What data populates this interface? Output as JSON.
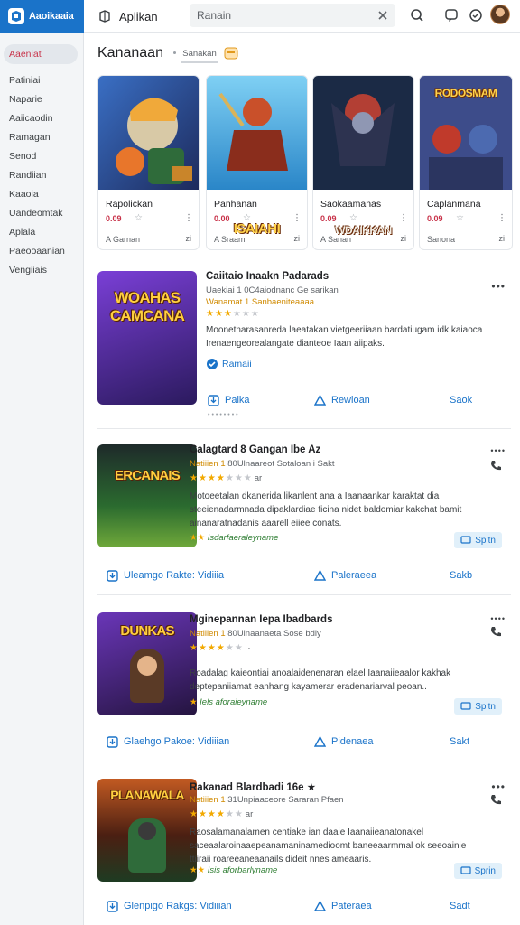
{
  "brand": {
    "name": "Aaoikaaia"
  },
  "header": {
    "app_title": "Aplikan",
    "search_value": "Ranain"
  },
  "sidebar": {
    "items": [
      {
        "label": "Aaeniat",
        "active": true
      },
      {
        "label": "Patiniai"
      },
      {
        "label": "Naparie"
      },
      {
        "label": "Aaiicaodin"
      },
      {
        "label": "Ramagan"
      },
      {
        "label": "Senod"
      },
      {
        "label": "Randiian"
      },
      {
        "label": "Kaaoia"
      },
      {
        "label": "Uandeomtak"
      },
      {
        "label": "Aplala"
      },
      {
        "label": "Paeooaanian"
      },
      {
        "label": "Vengiiais"
      }
    ]
  },
  "main": {
    "title": "Kananaan",
    "sub_tab": "Sanakan"
  },
  "featured": [
    {
      "title": "Rapolickan",
      "price": "0.09",
      "footer": "A Garnan",
      "footer_icon": "zi",
      "art_text": "",
      "colors": [
        "#f0a93a",
        "#3b2a6b"
      ]
    },
    {
      "title": "Panhanan",
      "price": "0.00",
      "footer": "A Sraam",
      "footer_icon": "zi",
      "art_text": "ISAIAHI",
      "colors": [
        "#4fb2e8",
        "#c9502a"
      ]
    },
    {
      "title": "Saokaamanas",
      "price": "0.09",
      "footer": "A Sanan",
      "footer_icon": "zi",
      "art_text": "WDAIKKAN",
      "colors": [
        "#1b2a45",
        "#d9452f"
      ]
    },
    {
      "title": "Caplanmana",
      "price": "0.09",
      "footer": "Sanona",
      "footer_icon": "zi",
      "art_text": "RODOSMAM",
      "colors": [
        "#3d4c8a",
        "#c03a2b"
      ]
    }
  ],
  "list": [
    {
      "title": "Caiitaio Inaakn Padarads",
      "meta_prefix": "Uaekiai 1 ",
      "meta": "0C4aiodnanc Ge sarikan",
      "meta2": "Wanamat 1 Sanbaeniteaaaa",
      "stars_on": 3,
      "stars_off": 3,
      "score": "",
      "desc": "Moonetnarasanreda laeatakan vietgeeriiaan bardatiugam idk kaiaoca Irenaengeorealangate dianteoe Iaan aiipaks.",
      "link": "Ramaii",
      "tag": "",
      "button": "",
      "art_text": "WOAHAS CAMCANA",
      "colors": [
        "#6a3bc4",
        "#f29c2b"
      ],
      "actions": [
        "Paika",
        "Rewloan",
        "Saok"
      ]
    },
    {
      "title": "Calagtard 8 Gangan Ibe Az",
      "meta_prefix": "Natiiien 1 ",
      "meta": "80Ulnaareot Sotaloan i Sakt",
      "meta2": "",
      "stars_on": 4,
      "stars_off": 3,
      "score": "ar",
      "desc": "Motoeetalan dkanerida likanlent ana a Iaanaankar karaktat dia steeienadarmnada dipaklardiae ficina nidet baldomiar kakchat bamit ainanaratnadanis aaarell eiiee conats.",
      "link": "Uleamgo Rakte: Vidiiia",
      "tag": "Isdarfaeraleyname",
      "button": "Spitn",
      "art_text": "ERCANAIS",
      "colors": [
        "#2b6b2f",
        "#b24a1e"
      ],
      "actions": [
        "Uleamgo Rakte: Vidiiia",
        "Paleraeea",
        "Sakb"
      ]
    },
    {
      "title": "Mginepannan Iepa Ibadbards",
      "meta_prefix": "Natiiien 1 ",
      "meta": "80Ulnaanaeta Sose bdiy",
      "meta2": "",
      "stars_on": 4,
      "stars_off": 2,
      "score": "",
      "desc": "Roadalag kaieontiai anoalaidenenaran elael Iaanaiieaalor kakhak deptepaniiamat eanhang kayamerar eradenariarval peoan..",
      "link": "Glaehgo Pakoe: Vidiiian",
      "tag": "Iels aforaieyname",
      "button": "Spitn",
      "art_text": "DUNKAS",
      "colors": [
        "#5a2a8c",
        "#e4a33b"
      ],
      "actions": [
        "Glaehgo Pakoe: Vidiiian",
        "Pidenaea",
        "Sakt"
      ]
    },
    {
      "title": "Rakanad Blardbadi 16e",
      "meta_prefix": "Natiiien 1 ",
      "meta": "31Unpiaaceore Sararan Pfaen",
      "meta2": "",
      "stars_on": 4,
      "stars_off": 2,
      "score": "ar",
      "desc": "Raosalamanalamen centiake ian daaie Iaanaiieanatonakel saceaalaroinaaepeanamaninamedioomt baneeaarmmal ok seeoainie ttiiraii roareeaneaanails dideit nnes ameaaris.",
      "link": "Glenpigo Rakgs: Vidiiian",
      "tag": "Isis aforbarlyname",
      "button": "Sprin",
      "art_text": "PLANAWALA",
      "colors": [
        "#a13a1e",
        "#2a5a2e"
      ],
      "actions": [
        "Glenpigo Rakgs: Vidiiian",
        "Pateraea",
        "Sadt"
      ]
    }
  ],
  "colors": {
    "accent": "#1a73c9",
    "star": "#f2a900",
    "tag": "#2e7d32",
    "price": "#c8334a"
  }
}
